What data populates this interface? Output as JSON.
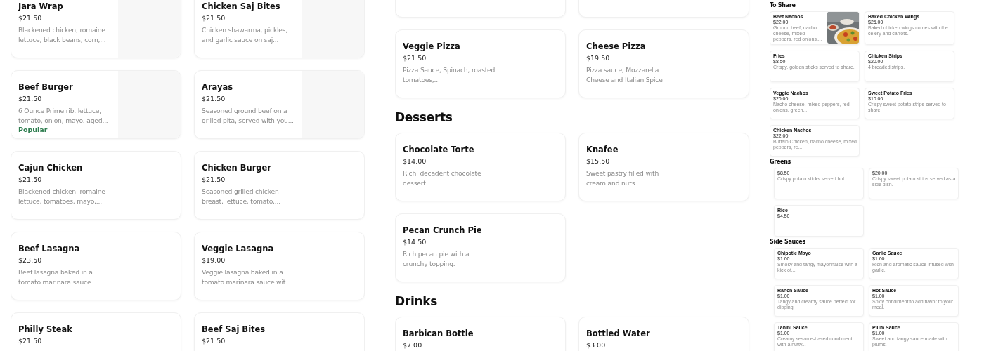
{
  "panels": [
    {
      "sections": [
        {
          "items": [
            {
              "kind": "item_with_image",
              "name": "Jara Wrap",
              "price": "$21.50",
              "description": "Blackened chicken, romaine lettuce, black beans, corn,..."
            },
            {
              "kind": "item_with_image",
              "name": "Chicken Saj Bites",
              "price": "$21.50",
              "description": "Chicken shawarma, pickles, and garlic sauce on saj..."
            },
            {
              "kind": "item_with_image",
              "name": "Beef Burger",
              "price": "$21.50",
              "description": "6 Ounce Prime rib, lettuce, tomato, onion, mayo. aged...",
              "badge": "Popular"
            },
            {
              "kind": "item_with_image",
              "name": "Arayas",
              "price": "$21.50",
              "description": "Seasoned ground beef on a grilled pita, served with you..."
            },
            {
              "kind": "item",
              "name": "Cajun Chicken",
              "price": "$21.50",
              "description": "Blackened chicken, romaine lettuce, tomatoes, mayo,..."
            },
            {
              "kind": "item",
              "name": "Chicken Burger",
              "price": "$21.50",
              "description": "Seasoned grilled chicken breast, lettuce, tomato,..."
            },
            {
              "kind": "item",
              "name": "Beef Lasagna",
              "price": "$23.50",
              "description": "Beef lasagna baked in a tomato marinara sauce..."
            },
            {
              "kind": "item",
              "name": "Veggie Lasagna",
              "price": "$19.00",
              "description": "Veggie lasagna baked in a tomato marinara sauce wit..."
            },
            {
              "kind": "item",
              "name": "Philly Steak",
              "price": "$21.50"
            },
            {
              "kind": "item",
              "name": "Beef  Saj Bites",
              "price": "$21.50"
            }
          ]
        }
      ]
    },
    {
      "sections": [
        {
          "items": [
            {
              "kind": "blank"
            },
            {
              "kind": "blank"
            },
            {
              "kind": "item",
              "name": "Veggie Pizza",
              "price": "$21.50",
              "description": "Pizza Sauce, Spinach, roasted tomatoes,..."
            },
            {
              "kind": "item",
              "name": "Cheese Pizza",
              "price": "$19.50",
              "description": "Pizza sauce, Mozzarella Cheese and Italian Spice"
            }
          ]
        },
        {
          "heading": "Desserts",
          "items": [
            {
              "kind": "item",
              "name": "Chocolate Torte",
              "price": "$14.00",
              "description": "Rich, decadent chocolate dessert."
            },
            {
              "kind": "item",
              "name": "Knafee",
              "price": "$15.50",
              "description": "Sweet pastry filled with cream and nuts."
            },
            {
              "kind": "item",
              "name": "Pecan Crunch Pie",
              "price": "$14.50",
              "description": "Rich pecan pie with a crunchy topping."
            }
          ]
        },
        {
          "heading": "Drinks",
          "items": [
            {
              "kind": "item",
              "name": "Barbican Bottle",
              "price": "$7.00"
            },
            {
              "kind": "item",
              "name": "Bottled Water",
              "price": "$3.00"
            }
          ]
        }
      ]
    },
    {
      "sections": [
        {
          "heading": "To Share",
          "items": [
            {
              "kind": "item_with_photo",
              "name": "Beef Nachos",
              "price": "$22.00",
              "description": "Ground beef, nacho cheese, mixed peppers, red onions,..."
            },
            {
              "kind": "item",
              "name": "Baked Chicken Wings",
              "price": "$25.00",
              "description": "Baked chicken wings comes with the celery and carrots."
            },
            {
              "kind": "item",
              "name": "Fries",
              "price": "$8.50",
              "description": "Crispy, golden sticks served to share."
            },
            {
              "kind": "item",
              "name": "Chicken Strips",
              "price": "$20.00",
              "description": "4 breaded strips."
            },
            {
              "kind": "item",
              "name": "Veggie Nachos",
              "price": "$20.00",
              "description": "Nacho cheese, mixed peppers, red onions, green..."
            },
            {
              "kind": "item",
              "name": "Sweet Potato Fries",
              "price": "$10.00",
              "description": "Crispy sweet potato strips served to share."
            },
            {
              "kind": "item",
              "name": "Chicken Nachos",
              "price": "$22.00",
              "description": "Buffalo Chicken, nacho cheese, mixed peppers, re..."
            }
          ]
        },
        {
          "heading": "Greens",
          "items": [
            {
              "kind": "item",
              "price": "$8.50",
              "description": "Crispy potato sticks served hot."
            },
            {
              "kind": "item",
              "price": "$20.00",
              "description": "Crispy sweet potato strips served as a side dish."
            },
            {
              "kind": "item",
              "name": "Rice",
              "price": "$4.50"
            }
          ]
        },
        {
          "heading": "Side Sauces",
          "items": [
            {
              "kind": "item",
              "name": "Chipotle Mayo",
              "price": "$1.00",
              "description": "Smoky and tangy mayonnaise with a kick of..."
            },
            {
              "kind": "item",
              "name": "Garlic Sauce",
              "price": "$1.00",
              "description": "Rich and aromatic sauce infused with garlic."
            },
            {
              "kind": "item",
              "name": "Ranch Sauce",
              "price": "$1.00",
              "description": "Tangy and creamy sauce perfect for dipping."
            },
            {
              "kind": "item",
              "name": "Hot Sauce",
              "price": "$1.00",
              "description": "Spicy condiment to add flavor to your meal."
            },
            {
              "kind": "item",
              "name": "Tahini Sauce",
              "price": "$1.00",
              "description": "Creamy sesame-based condiment with a nutty..."
            },
            {
              "kind": "item",
              "name": "Plum Sauce",
              "price": "$1.00",
              "description": "Sweet and tangy sauce made with plums."
            }
          ]
        }
      ]
    }
  ]
}
